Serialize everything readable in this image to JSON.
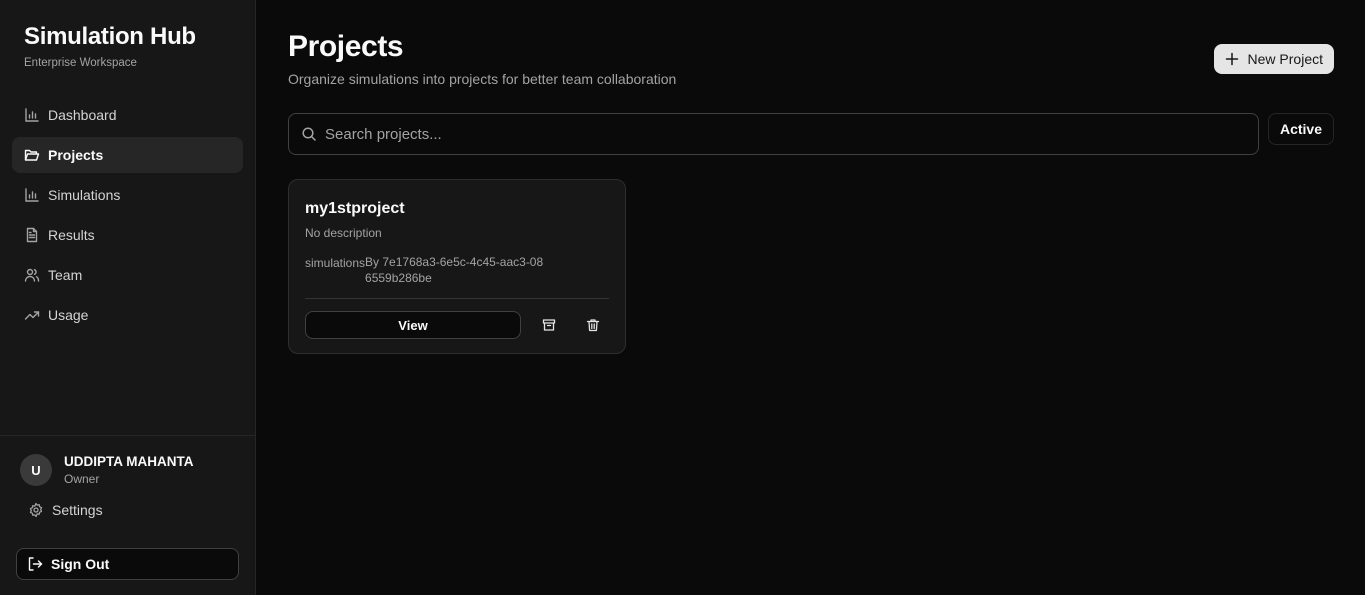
{
  "brand": {
    "title": "Simulation Hub",
    "subtitle": "Enterprise Workspace"
  },
  "nav": [
    {
      "label": "Dashboard",
      "icon": "bar-chart-icon",
      "active": false
    },
    {
      "label": "Projects",
      "icon": "folder-open-icon",
      "active": true
    },
    {
      "label": "Simulations",
      "icon": "bar-chart-icon",
      "active": false
    },
    {
      "label": "Results",
      "icon": "file-text-icon",
      "active": false
    },
    {
      "label": "Team",
      "icon": "users-icon",
      "active": false
    },
    {
      "label": "Usage",
      "icon": "trending-up-icon",
      "active": false
    }
  ],
  "user": {
    "initial": "U",
    "name": "UDDIPTA MAHANTA",
    "role": "Owner"
  },
  "settings_label": "Settings",
  "signout_label": "Sign Out",
  "page": {
    "title": "Projects",
    "subtitle": "Organize simulations into projects for better team collaboration",
    "new_project_label": "New Project"
  },
  "search": {
    "placeholder": "Search projects...",
    "value": ""
  },
  "filter": {
    "selected": "Active"
  },
  "projects": [
    {
      "name": "my1stproject",
      "description": "No description",
      "simulations_label": "simulations",
      "owner": "By 7e1768a3-6e5c-4c45-aac3-086559b286be",
      "view_label": "View"
    }
  ],
  "colors": {
    "background": "#0a0a0a",
    "sidebar": "#171717",
    "active_nav": "#262626",
    "primary_button": "#e5e5e5",
    "muted_text": "#a3a3a3"
  }
}
